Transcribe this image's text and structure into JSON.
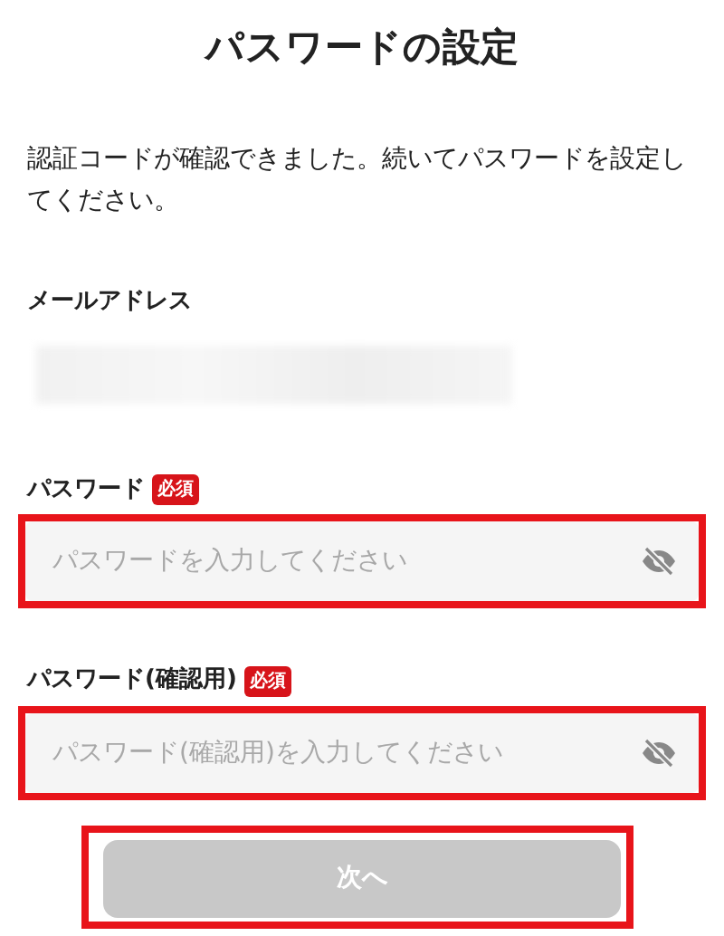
{
  "title": "パスワードの設定",
  "intro": "認証コードが確認できました。続いてパスワードを設定してください。",
  "email": {
    "label": "メールアドレス",
    "blurred": true
  },
  "fields": [
    {
      "label": "パスワード",
      "required_badge": "必須",
      "placeholder": "パスワードを入力してください",
      "highlighted": true
    },
    {
      "label": "パスワード(確認用)",
      "required_badge": "必須",
      "placeholder": "パスワード(確認用)を入力してください",
      "highlighted": true
    }
  ],
  "next_button": {
    "label": "次へ",
    "disabled": true,
    "highlighted": true
  }
}
